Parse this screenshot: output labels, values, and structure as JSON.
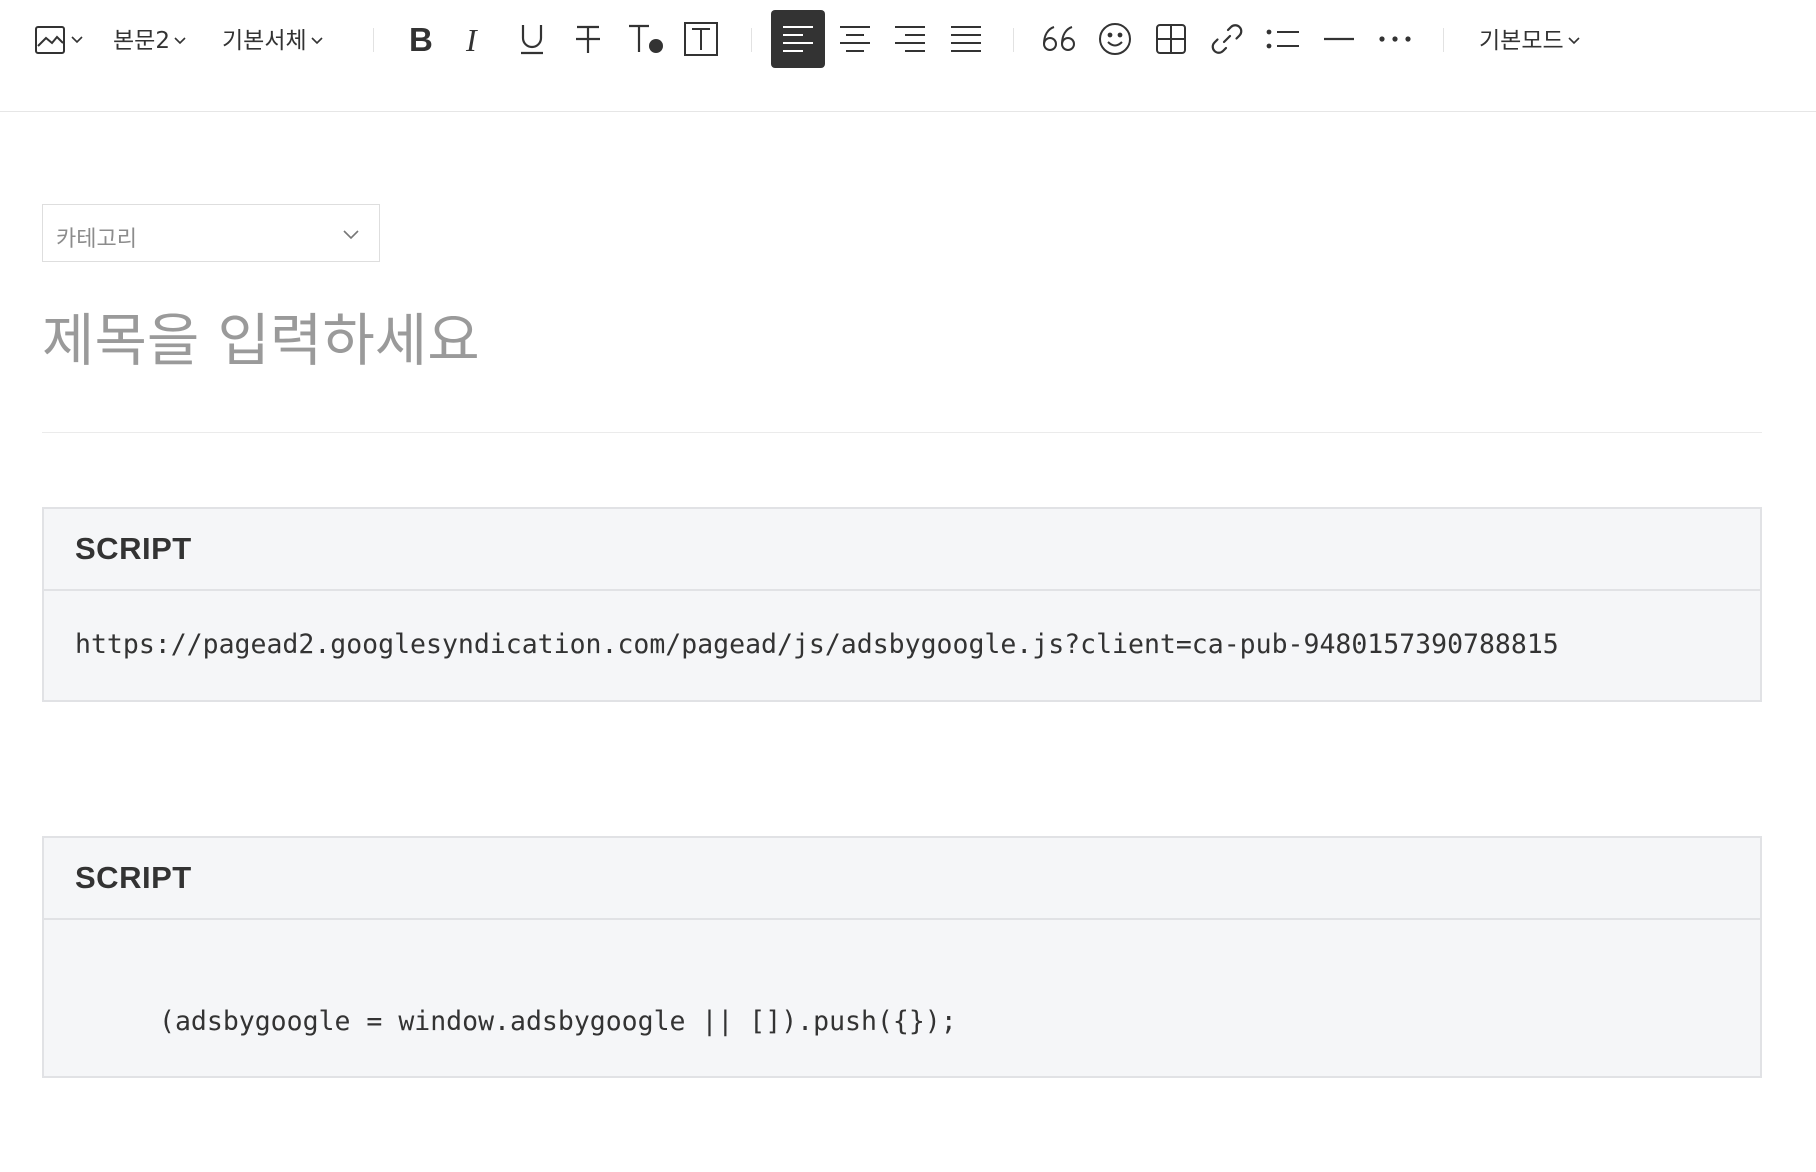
{
  "toolbar": {
    "paragraph_style": "본문2",
    "font_family": "기본서체",
    "mode": "기본모드",
    "buttons": {
      "image": "image-icon",
      "bold": "bold-icon",
      "italic": "italic-icon",
      "underline": "underline-icon",
      "strikethrough": "strikethrough-icon",
      "text_color": "text-color-icon",
      "text_background": "text-background-icon",
      "align_left": "align-left-icon",
      "align_center": "align-center-icon",
      "align_right": "align-right-icon",
      "align_justify": "align-justify-icon",
      "quote": "quote-icon",
      "emoji": "emoji-icon",
      "table": "table-icon",
      "link": "link-icon",
      "list": "list-icon",
      "divider": "divider-icon",
      "more": "more-icon"
    },
    "active_alignment": "left"
  },
  "editor": {
    "category_placeholder": "카테고리",
    "title_placeholder": "제목을 입력하세요",
    "blocks": [
      {
        "type": "SCRIPT",
        "code": "https://pagead2.googlesyndication.com/pagead/js/adsbygoogle.js?client=ca-pub-9480157390788815"
      },
      {
        "type": "SCRIPT",
        "code": "(adsbygoogle = window.adsbygoogle || []).push({});"
      }
    ]
  },
  "colors": {
    "active_button_bg": "#333333",
    "code_block_bg": "#f5f6f8",
    "code_block_border": "#e1e2e5",
    "placeholder_text": "#9a9a9a"
  }
}
